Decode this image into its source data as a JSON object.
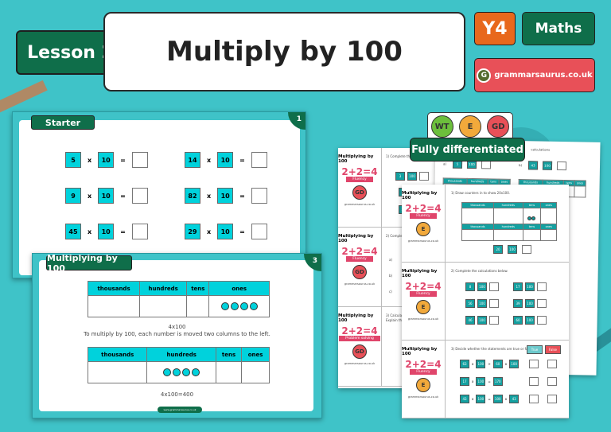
{
  "header": {
    "lesson_label": "Lesson 2",
    "title": "Multiply by 100",
    "year": "Y4",
    "subject": "Maths",
    "brand": "grammarsaurus.co.uk",
    "brand_logo_letter": "G"
  },
  "colors": {
    "background": "#3fc3c8",
    "dark_green": "#0f6e4a",
    "orange": "#e8681c",
    "red": "#e85058",
    "cyan": "#00d2dc"
  },
  "slide1": {
    "tag": "Starter",
    "number": "1",
    "equations": [
      {
        "a": "5",
        "b": "10"
      },
      {
        "a": "14",
        "b": "10"
      },
      {
        "a": "9",
        "b": "10"
      },
      {
        "a": "82",
        "b": "10"
      },
      {
        "a": "45",
        "b": "10"
      },
      {
        "a": "29",
        "b": "10"
      }
    ],
    "times": "x",
    "equals": "="
  },
  "slide3": {
    "tag": "Multiplying by 100",
    "number": "3",
    "headers": [
      "thousands",
      "hundreds",
      "tens",
      "ones"
    ],
    "caption1": "4x100",
    "caption2": "To multiply by 100, each number is moved two columns to the left.",
    "caption3": "4x100=400",
    "footer": "www.grammarsaurus.co.uk"
  },
  "badges": {
    "wt": "WT",
    "e": "E",
    "gd": "GD",
    "label": "Fully differentiated"
  },
  "worksheet_front": {
    "title": "Multiplying by 100",
    "fluency_sum": "2+2=4",
    "fluency_label": "Fluency",
    "level": "E",
    "footer": "grammarsaurus.co.uk",
    "q1": "1) Draw counters in to show 20x100.",
    "q1_headers": [
      "thousands",
      "hundreds",
      "tens",
      "ones"
    ],
    "q1_eq": {
      "a": "20",
      "b": "100"
    },
    "q2": "2) Complete the calculations below.",
    "q2_eqs": [
      {
        "a": "8",
        "b": "100"
      },
      {
        "a": "17",
        "b": "100"
      },
      {
        "a": "56",
        "b": "100"
      },
      {
        "a": "39",
        "b": "100"
      },
      {
        "a": "46",
        "b": "100"
      },
      {
        "a": "60",
        "b": "100"
      }
    ],
    "q3": "3) Decide whether the statements are true or false.",
    "true_label": "True",
    "false_label": "False",
    "q3_statements": [
      [
        "63",
        "x",
        "100",
        ">",
        "60",
        "x",
        "100"
      ],
      [
        "17",
        "x",
        "100",
        "=",
        "170"
      ],
      [
        "43",
        "x",
        "100",
        "=",
        "100",
        "x",
        "43"
      ]
    ]
  },
  "worksheet_left": {
    "title": "Multiplying by 100",
    "level": "GD",
    "fluency_sum": "2+2=4",
    "fluency_label": "Fluency",
    "problem_label": "Problem solving",
    "footer": "grammarsaurus.co.uk",
    "q1": "1) Complete the calc",
    "q2": "2) Complete",
    "q3": "3) Calculate",
    "q3b": "Explain the",
    "q1_eqs": [
      {
        "a": "3",
        "b": "100"
      },
      {
        "a": "55"
      },
      {
        "a": "30"
      }
    ],
    "parts": [
      "a)",
      "b)",
      "c)"
    ]
  },
  "worksheet_right": {
    "q": "calculations",
    "parts": [
      {
        "label": "a)",
        "a": "5",
        "b": "100"
      },
      {
        "label": "b)",
        "a": "43",
        "b": "100"
      }
    ],
    "headers": [
      "thousands",
      "hundreds",
      "tens",
      "ones"
    ]
  }
}
